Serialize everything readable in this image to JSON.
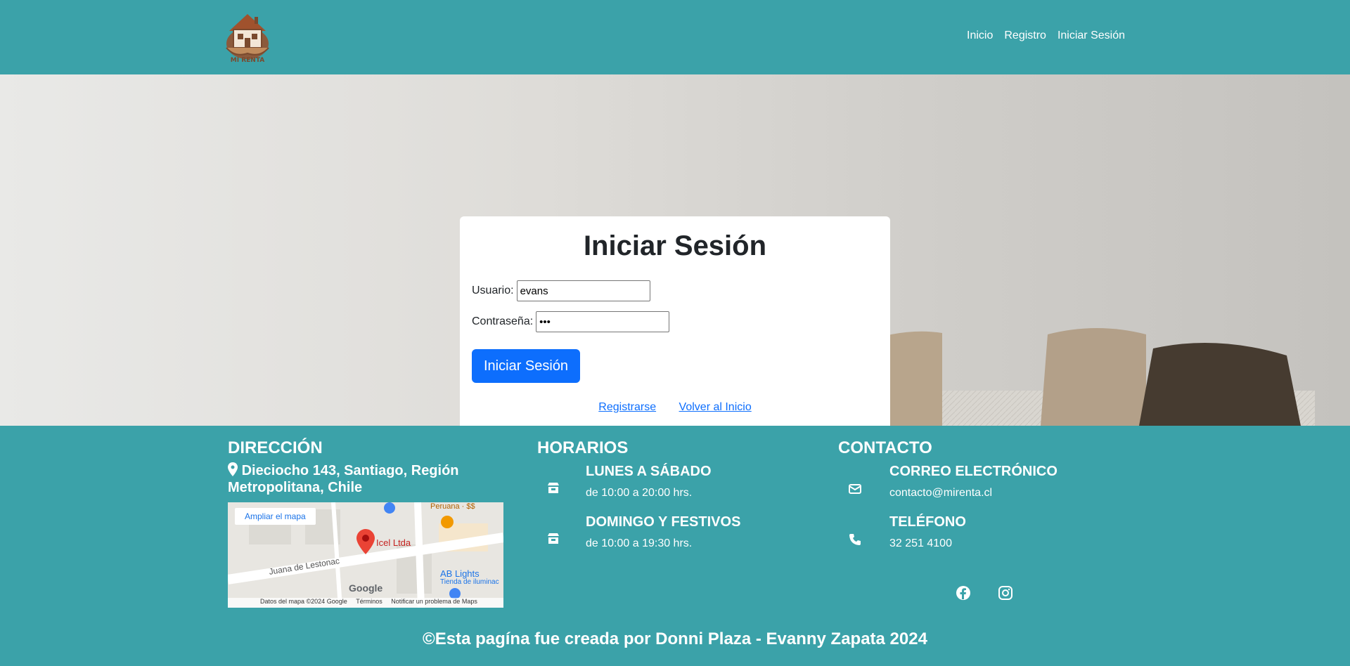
{
  "header": {
    "logo_text": "MI RENTA",
    "nav": [
      "Inicio",
      "Registro",
      "Iniciar Sesión"
    ]
  },
  "login": {
    "title": "Iniciar Sesión",
    "user_label": "Usuario:",
    "user_value": "evans",
    "password_label": "Contraseña:",
    "password_value": "•••",
    "submit_label": "Iniciar Sesión",
    "register_link": "Registrarse",
    "home_link": "Volver al Inicio"
  },
  "footer": {
    "address_title": "DIRECCIÓN",
    "address": "Dieciocho 143, Santiago, Región Metropolitana, Chile",
    "map": {
      "expand_button": "Ampliar el mapa",
      "place_label": "Icel Ltda",
      "street_label": "Juana de Lestonac",
      "poi_1": "Peruana · $$",
      "poi_2": "AB Lights",
      "poi_2_sub": "Tienda de iluminac",
      "brand": "Google",
      "attribution": "Datos del mapa ©2024 Google",
      "terms": "Términos",
      "report": "Notificar un problema de Maps"
    },
    "hours_title": "HORARIOS",
    "hours": [
      {
        "title": "LUNES A SÁBADO",
        "text": "de 10:00 a 20:00 hrs."
      },
      {
        "title": "DOMINGO Y FESTIVOS",
        "text": "de 10:00 a 19:30 hrs."
      }
    ],
    "contact_title": "CONTACTO",
    "contact": [
      {
        "title": "CORREO ELECTRÓNICO",
        "text": "contacto@mirenta.cl"
      },
      {
        "title": "TELÉFONO",
        "text": "32 251 4100"
      }
    ],
    "credit": "©Esta pagína fue creada por Donni Plaza - Evanny Zapata 2024"
  },
  "colors": {
    "teal": "#3ba2a9",
    "primary": "#0d6efd"
  }
}
